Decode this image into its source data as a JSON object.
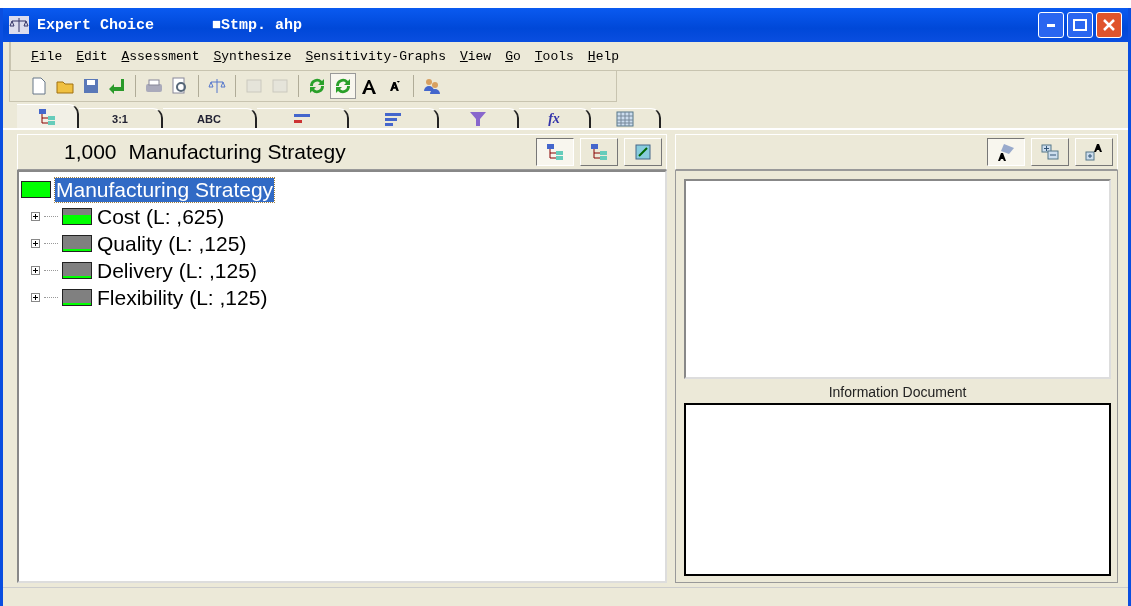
{
  "window": {
    "title": "Expert Choice",
    "file": "■Stmp. ahp"
  },
  "menu": [
    "File",
    "Edit",
    "Assessment",
    "Synthesize",
    "Sensitivity-Graphs",
    "View",
    "Go",
    "Tools",
    "Help"
  ],
  "toolbar": [
    [
      {
        "kind": "new",
        "pressed": false,
        "disabled": false
      },
      {
        "kind": "open",
        "pressed": false,
        "disabled": false
      },
      {
        "kind": "save",
        "pressed": false,
        "disabled": false
      },
      {
        "kind": "enter",
        "pressed": false,
        "disabled": false
      }
    ],
    [
      {
        "kind": "print",
        "pressed": false,
        "disabled": false
      },
      {
        "kind": "preview",
        "pressed": false,
        "disabled": false
      }
    ],
    [
      {
        "kind": "balance",
        "pressed": false,
        "disabled": false
      }
    ],
    [
      {
        "kind": "sheet",
        "pressed": false,
        "disabled": true
      },
      {
        "kind": "sheet",
        "pressed": false,
        "disabled": true
      }
    ],
    [
      {
        "kind": "refresh",
        "pressed": false,
        "disabled": false
      },
      {
        "kind": "refresh",
        "pressed": true,
        "disabled": false
      },
      {
        "kind": "font-up",
        "pressed": false,
        "disabled": false
      },
      {
        "kind": "font-down",
        "pressed": false,
        "disabled": false
      }
    ],
    [
      {
        "kind": "people",
        "pressed": false,
        "disabled": false
      }
    ]
  ],
  "tabs": [
    {
      "kind": "tree",
      "selected": true
    },
    {
      "kind": "text",
      "label": "3:1",
      "selected": false
    },
    {
      "kind": "text",
      "label": "ABC",
      "selected": false
    },
    {
      "kind": "bars",
      "selected": false
    },
    {
      "kind": "lines",
      "selected": false
    },
    {
      "kind": "funnel",
      "selected": false
    },
    {
      "kind": "fx",
      "label": "fx",
      "selected": false
    },
    {
      "kind": "grid",
      "selected": false
    }
  ],
  "goal_header": {
    "value": "1,000",
    "name": "Manufacturing Strategy",
    "views": [
      {
        "kind": "tree",
        "selected": true
      },
      {
        "kind": "nodes",
        "selected": false
      },
      {
        "kind": "edit",
        "selected": false
      }
    ]
  },
  "tree": {
    "label": "Manufacturing Strategy",
    "kind": "full",
    "selected": true,
    "children": [
      {
        "label": "Cost (L: ,625)",
        "kind": "major",
        "selected": false,
        "expanded": false
      },
      {
        "label": "Quality (L: ,125)",
        "kind": "minor",
        "selected": false,
        "expanded": false
      },
      {
        "label": "Delivery (L: ,125)",
        "kind": "minor",
        "selected": false,
        "expanded": false
      },
      {
        "label": "Flexibility (L: ,125)",
        "kind": "minor",
        "selected": false,
        "expanded": false
      }
    ]
  },
  "right_panel": {
    "buttons": [
      {
        "kind": "note",
        "selected": true
      },
      {
        "kind": "expand",
        "selected": false
      },
      {
        "kind": "add-text",
        "selected": false
      }
    ],
    "info_label": "Information Document"
  }
}
